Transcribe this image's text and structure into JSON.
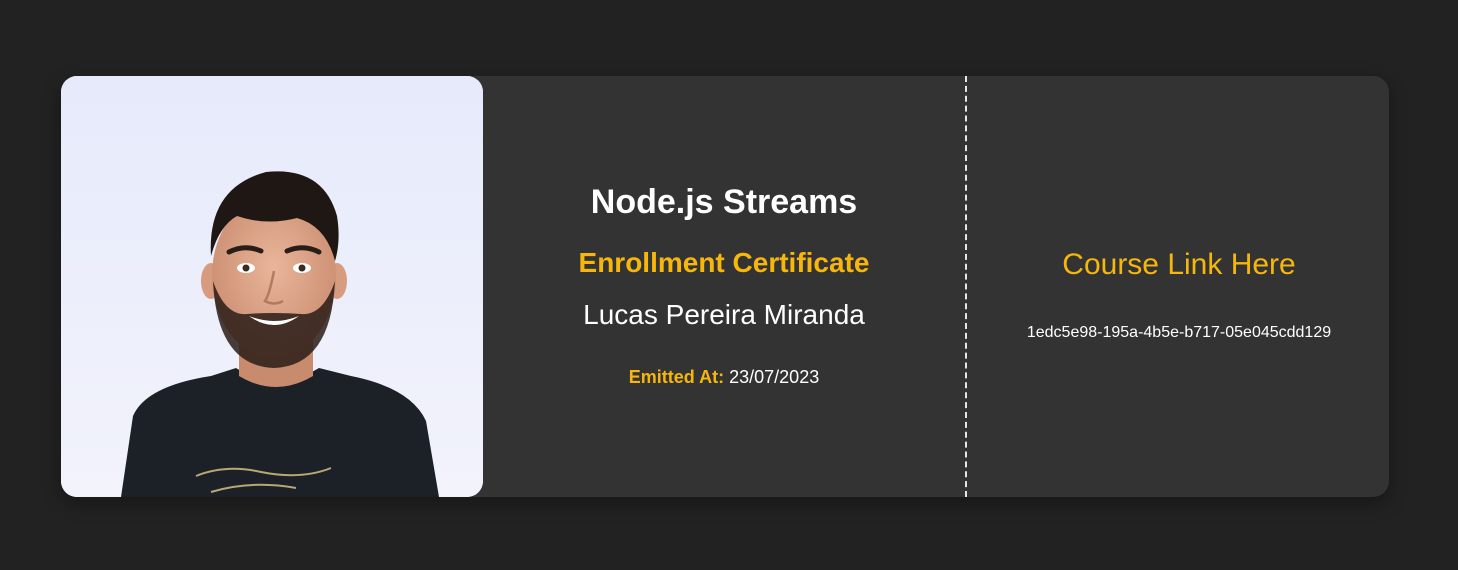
{
  "certificate": {
    "course_title": "Node.js Streams",
    "certificate_type": "Enrollment Certificate",
    "student_name": "Lucas Pereira Miranda",
    "emitted_label": "Emitted At:",
    "emitted_date": "23/07/2023",
    "course_link_text": "Course Link Here",
    "certificate_id": "1edc5e98-195a-4b5e-b717-05e045cdd129",
    "photo_alt": "student portrait photo"
  },
  "colors": {
    "background": "#222222",
    "card": "#333333",
    "accent": "#f6b60c",
    "text": "#ffffff"
  }
}
